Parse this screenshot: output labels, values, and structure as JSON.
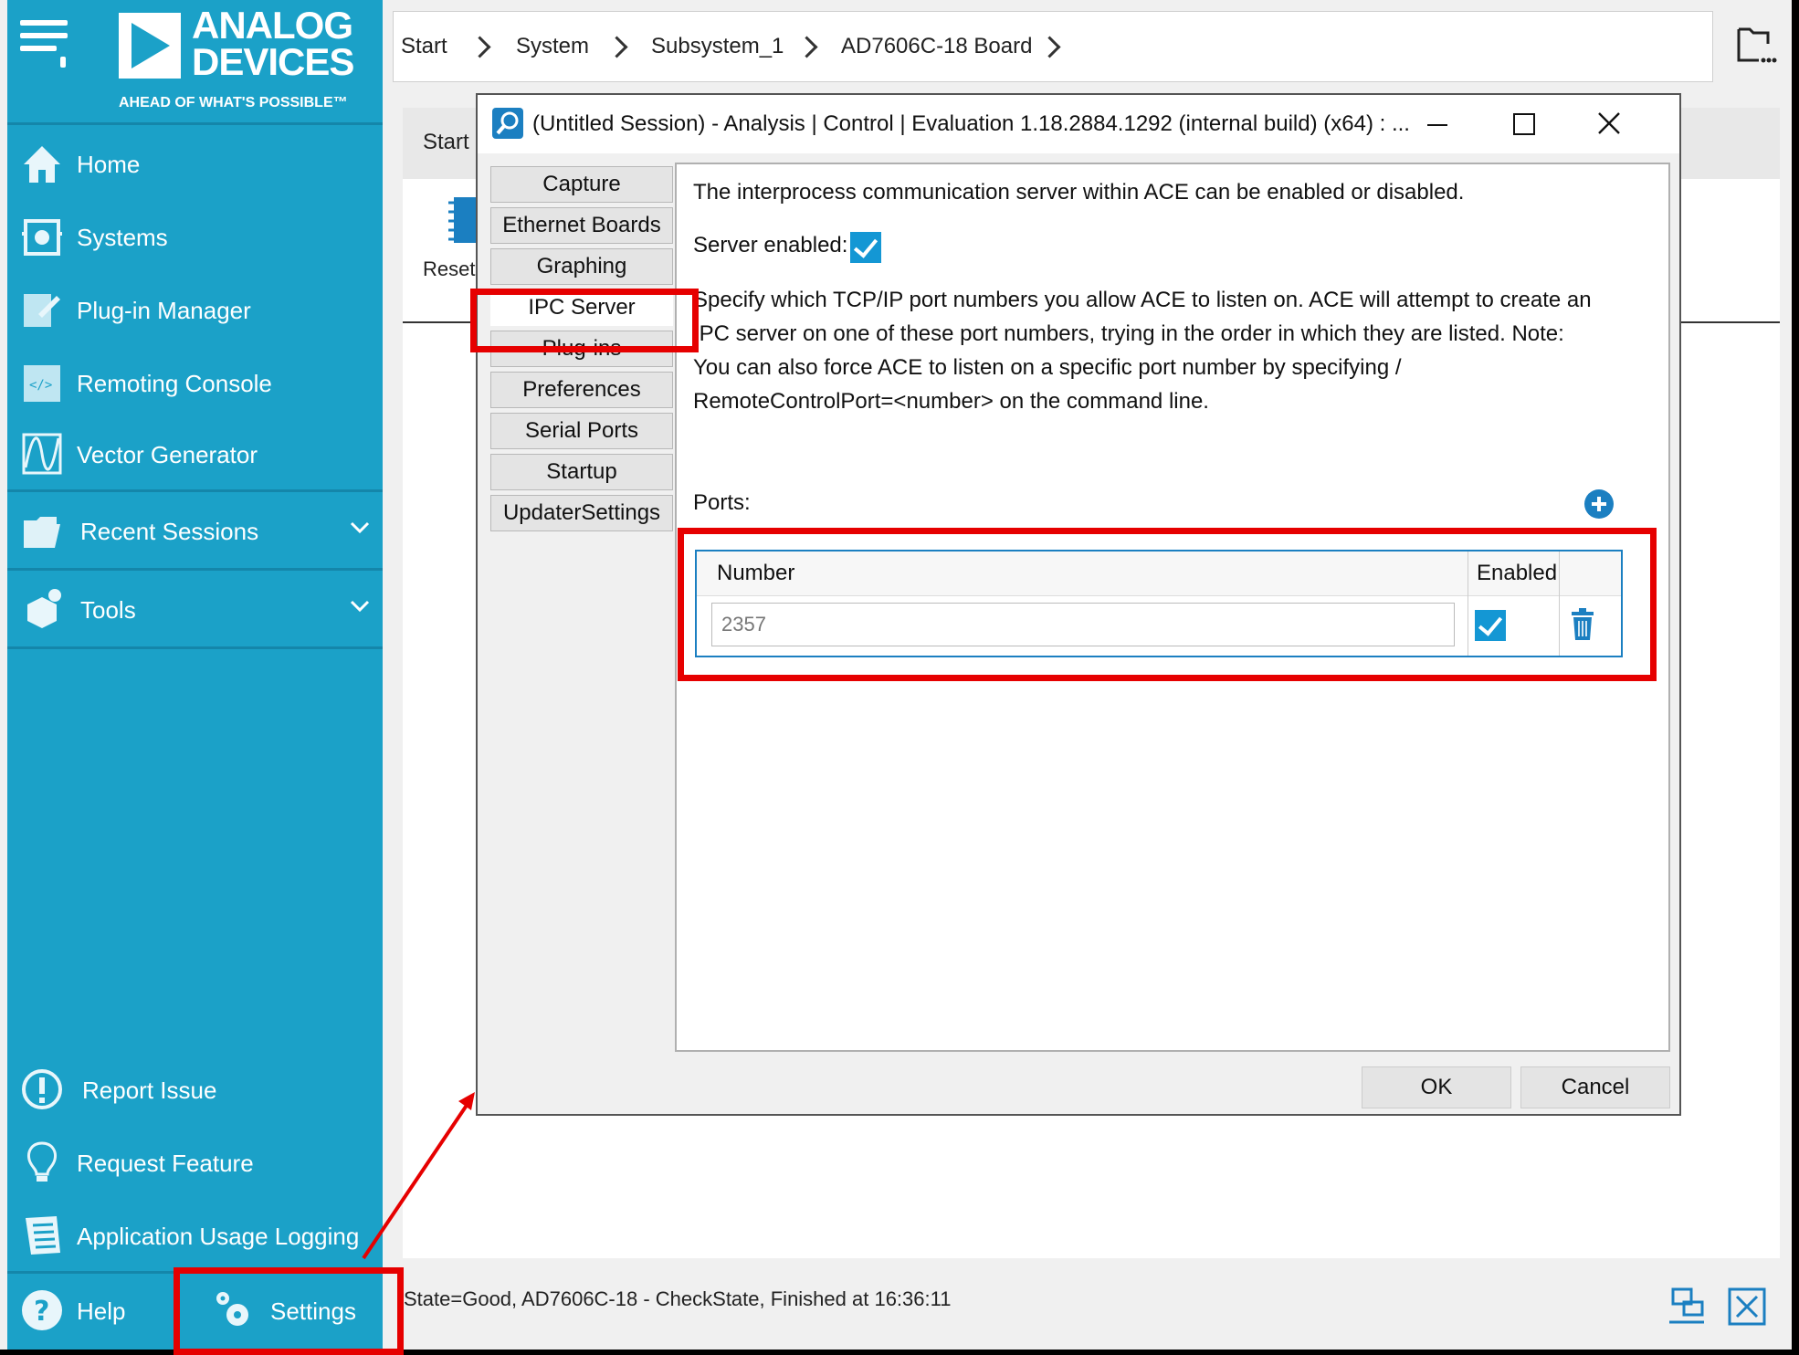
{
  "window": {
    "title": "(Untitled Session) - Analysis | Control | Evaluation 1.18.2884.1292 (internal build) (x64) : ..."
  },
  "brand": {
    "name_line1": "ANALOG",
    "name_line2": "DEVICES",
    "tagline": "AHEAD OF WHAT'S POSSIBLE™"
  },
  "sidebar": {
    "items": [
      {
        "label": "Home",
        "icon": "home-icon"
      },
      {
        "label": "Systems",
        "icon": "systems-icon"
      },
      {
        "label": "Plug-in Manager",
        "icon": "plugin-manager-icon"
      },
      {
        "label": "Remoting Console",
        "icon": "remoting-console-icon"
      },
      {
        "label": "Vector Generator",
        "icon": "vector-generator-icon"
      },
      {
        "label": "Recent Sessions",
        "icon": "folder-icon"
      },
      {
        "label": "Tools",
        "icon": "tools-icon"
      }
    ],
    "bottom_items": [
      {
        "label": "Report Issue",
        "icon": "exclamation-icon"
      },
      {
        "label": "Request Feature",
        "icon": "lightbulb-icon"
      },
      {
        "label": "Application Usage Logging",
        "icon": "usage-logging-icon"
      },
      {
        "label": "Help",
        "icon": "help-icon"
      },
      {
        "label": "Settings",
        "icon": "gears-icon"
      }
    ]
  },
  "breadcrumb": [
    "Start",
    "System",
    "Subsystem_1",
    "AD7606C-18 Board"
  ],
  "content": {
    "tab_label": "Start",
    "reset_label": "Reset"
  },
  "status": {
    "text": "State=Good, AD7606C-18 - CheckState, Finished at 16:36:11"
  },
  "dialog": {
    "tabs": [
      "Capture",
      "Ethernet Boards",
      "Graphing",
      "IPC Server",
      "Plug-ins",
      "Preferences",
      "Serial Ports",
      "Startup",
      "UpdaterSettings"
    ],
    "active_tab": "IPC Server",
    "intro": "The interprocess communication server within ACE can be enabled or disabled.",
    "server_enabled_label": "Server enabled:",
    "server_enabled": true,
    "description_lines": [
      "Specify which TCP/IP port numbers you allow ACE to listen on.  ACE will attempt to create an",
      "IPC server on one of these port numbers, trying in the order in which they are listed.  Note:",
      "You can also force ACE to listen on a specific port number by specifying /",
      "RemoteControlPort=<number> on the command line."
    ],
    "ports_label": "Ports:",
    "grid": {
      "col_number": "Number",
      "col_enabled": "Enabled",
      "rows": [
        {
          "number": "2357",
          "enabled": true
        }
      ]
    },
    "ok_label": "OK",
    "cancel_label": "Cancel"
  },
  "colors": {
    "sidebar": "#1ba1c8",
    "accent": "#1497d4",
    "annotation": "#e60000"
  }
}
